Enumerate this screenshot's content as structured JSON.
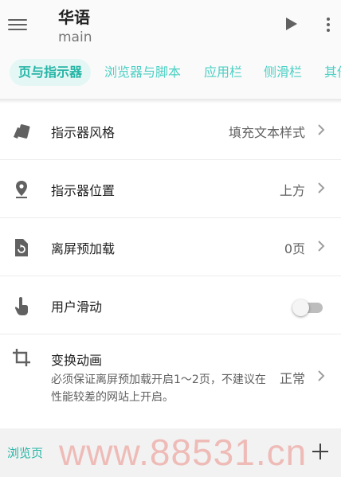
{
  "app": {
    "title": "华语",
    "subtitle": "main"
  },
  "toolbar": {
    "icons": [
      "menu-icon",
      "play-icon",
      "more-vert-icon"
    ]
  },
  "tabs": [
    {
      "label": "页与指示器",
      "active": true
    },
    {
      "label": "浏览器与脚本",
      "active": false
    },
    {
      "label": "应用栏",
      "active": false
    },
    {
      "label": "侧滑栏",
      "active": false
    },
    {
      "label": "其他",
      "active": false
    }
  ],
  "settings": [
    {
      "label": "指示器风格",
      "value": "填充文本样式",
      "icon": "cards-icon"
    },
    {
      "label": "指示器位置",
      "value": "上方",
      "icon": "location-pin-icon"
    },
    {
      "label": "离屏预加载",
      "value": "0页",
      "icon": "file-refresh-icon"
    },
    {
      "label": "用户滑动",
      "toggle": false,
      "icon": "touch-hand-icon"
    },
    {
      "label": "变换动画",
      "description": "必须保证离屏预加载开启1～2页，不建议在性能较差的网站上开启。",
      "value": "正常",
      "icon": "crop-icon"
    }
  ],
  "bottom": {
    "label": "浏览页"
  },
  "watermark": "www.88531.cn",
  "colors": {
    "accent": "#26b5a6",
    "tab_inactive": "#4dd0c4",
    "tab_active_bg": "#e4f7f5",
    "watermark": "#e8786e"
  }
}
